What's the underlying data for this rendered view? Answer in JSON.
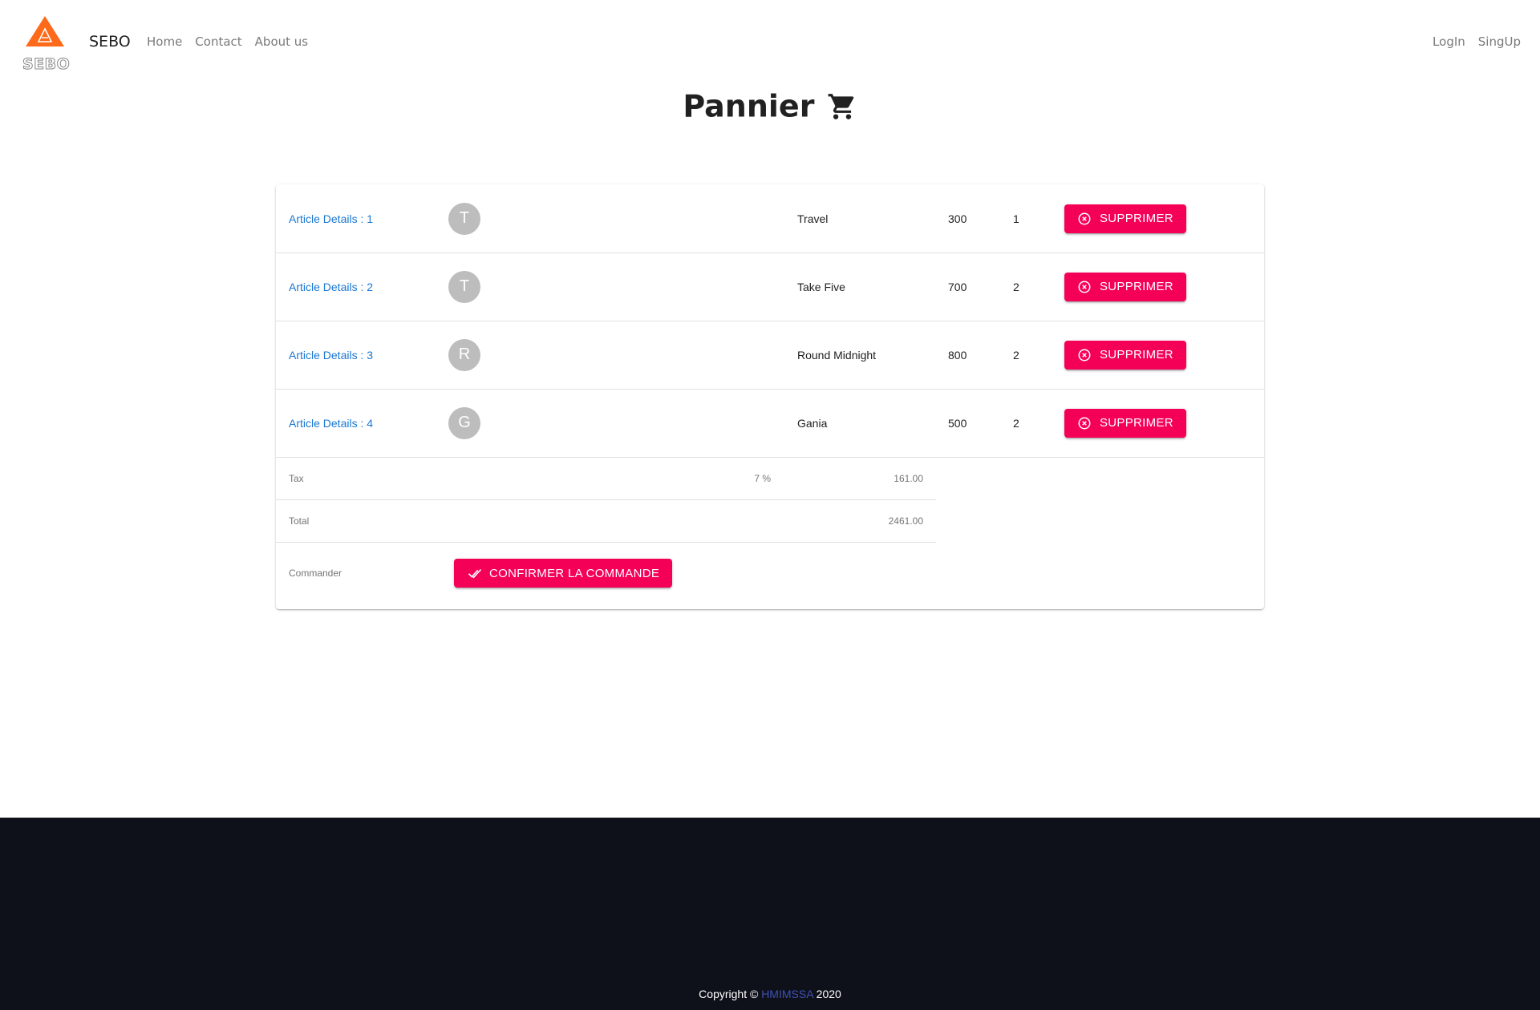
{
  "nav": {
    "logo_text": "SEBO",
    "brand": "SEBO",
    "links": [
      "Home",
      "Contact",
      "About us"
    ],
    "right_links": [
      "LogIn",
      "SingUp"
    ]
  },
  "page": {
    "title": "Pannier",
    "title_icon": "shopping-cart-icon"
  },
  "cart": {
    "items": [
      {
        "link": "Article Details : 1",
        "avatar": "T",
        "name": "Travel",
        "price": "300",
        "qty": "1",
        "action": "SUPPRIMER"
      },
      {
        "link": "Article Details : 2",
        "avatar": "T",
        "name": "Take Five",
        "price": "700",
        "qty": "2",
        "action": "SUPPRIMER"
      },
      {
        "link": "Article Details : 3",
        "avatar": "R",
        "name": "Round Midnight",
        "price": "800",
        "qty": "2",
        "action": "SUPPRIMER"
      },
      {
        "link": "Article Details : 4",
        "avatar": "G",
        "name": "Gania",
        "price": "500",
        "qty": "2",
        "action": "SUPPRIMER"
      }
    ],
    "tax": {
      "label": "Tax",
      "rate": "7 %",
      "value": "161.00"
    },
    "total": {
      "label": "Total",
      "value": "2461.00"
    },
    "order": {
      "label": "Commander",
      "button": "CONFIRMER LA COMMANDE"
    }
  },
  "footer": {
    "prefix": "Copyright © ",
    "brand": "HMIMSSA",
    "suffix": " 2020"
  },
  "colors": {
    "accent": "#f50057",
    "link": "#1976d2",
    "footer_bg": "#0e111a",
    "logo": "#ff6a1a"
  }
}
